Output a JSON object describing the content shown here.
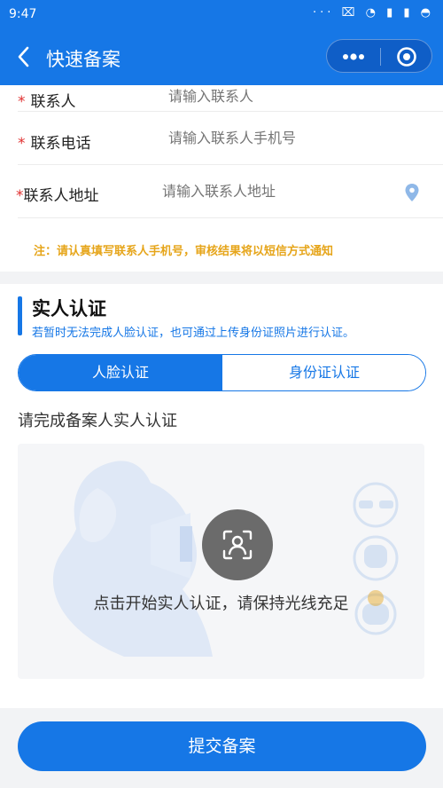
{
  "status_bar": {
    "time": "9:47",
    "icons": "··· ⌧ ◔ ▮ ▮ ◓"
  },
  "nav": {
    "title": "快速备案"
  },
  "form": {
    "rows": [
      {
        "label": "联系人",
        "placeholder": "请输入联系人",
        "required": "*"
      },
      {
        "label": "联系电话",
        "placeholder": "请输入联系人手机号",
        "required": "*"
      },
      {
        "label": "联系人地址",
        "placeholder": "请输入联系人地址",
        "required": "*"
      }
    ],
    "note": "注：请认真填写联系人手机号，审核结果将以短信方式通知"
  },
  "auth": {
    "title": "实人认证",
    "subtitle": "若暂时无法完成人脸认证，也可通过上传身份证照片进行认证。",
    "tabs": [
      {
        "label": "人脸认证",
        "active": true
      },
      {
        "label": "身份证认证",
        "active": false
      }
    ],
    "instruction": "请完成备案人实人认证",
    "scan_text": "点击开始实人认证，请保持光线充足"
  },
  "submit": {
    "label": "提交备案"
  },
  "colors": {
    "primary": "#1677e6",
    "note": "#e6a51a",
    "required": "#e03030"
  },
  "icons": [
    "back-icon",
    "more-icon",
    "close-capsule-icon",
    "location-icon",
    "face-scan-icon"
  ]
}
